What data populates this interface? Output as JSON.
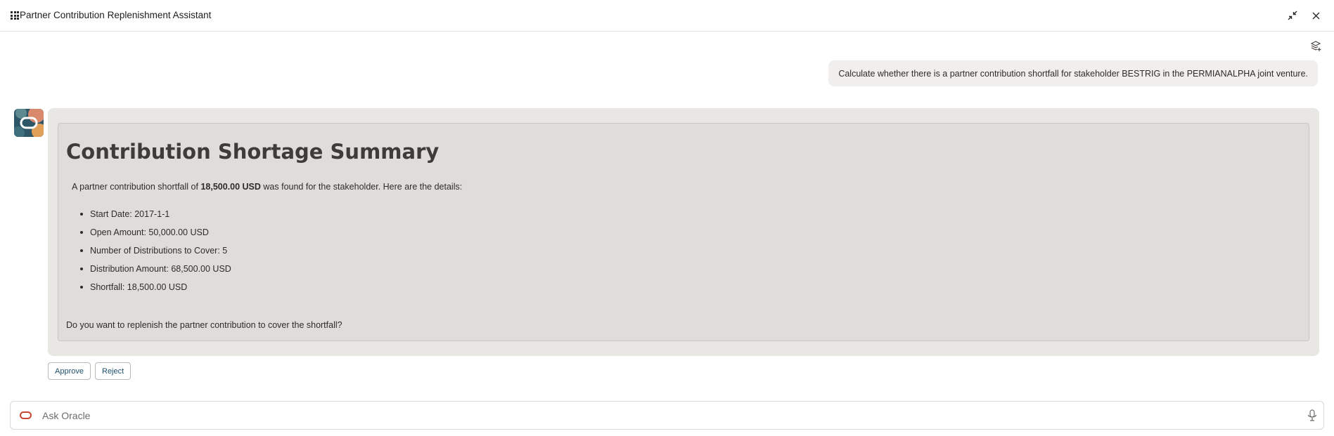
{
  "header": {
    "title": "Partner Contribution Replenishment Assistant",
    "icons": {
      "apps": "grid-icon",
      "minimize": "collapse-arrows-icon",
      "close": "close-icon",
      "layers": "layers-icon"
    }
  },
  "conversation": {
    "user_message": "Calculate whether there is a partner contribution shortfall for stakeholder BESTRIG in the PERMIANALPHA joint venture.",
    "response": {
      "title": "Contribution Shortage Summary",
      "intro_prefix": "A partner contribution shortfall of ",
      "intro_amount": "18,500.00 USD",
      "intro_suffix": " was found for the stakeholder. Here are the details:",
      "details": [
        "Start Date: 2017-1-1",
        "Open Amount: 50,000.00 USD",
        "Number of Distributions to Cover: 5",
        "Distribution Amount: 68,500.00 USD",
        "Shortfall: 18,500.00 USD"
      ],
      "question": "Do you want to replenish the partner contribution to cover the shortfall?"
    },
    "actions": {
      "approve_label": "Approve",
      "reject_label": "Reject"
    }
  },
  "input": {
    "placeholder": "Ask Oracle",
    "value": ""
  },
  "colors": {
    "accent": "#c74634",
    "button_text": "#1f4f6b",
    "panel_outer": "#e9e7e3",
    "panel_inner": "#dfddd9",
    "user_bubble": "#f1efed"
  }
}
